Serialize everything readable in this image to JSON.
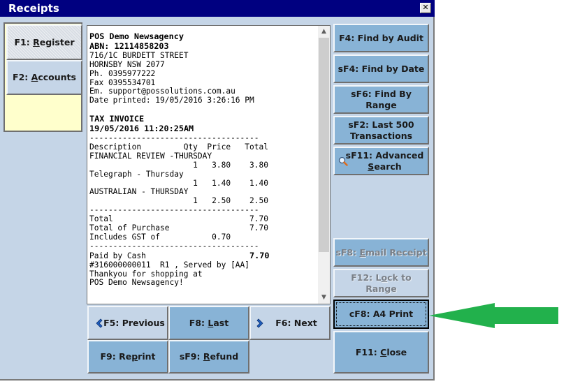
{
  "window": {
    "title": "Receipts",
    "close_glyph": "✕"
  },
  "left_panel": {
    "register": {
      "key": "F1: ",
      "mnemonic": "R",
      "rest": "egister"
    },
    "accounts": {
      "key": "F2: ",
      "mnemonic": "A",
      "rest": "ccounts"
    }
  },
  "receipt": {
    "store_name": "POS Demo Newsagency",
    "abn": "ABN: 12114858203",
    "address1": "716/1C BURDETT STREET",
    "address2": "HORNSBY NSW 2077",
    "phone": "Ph. 0395977222",
    "fax": "Fax 0395534701",
    "email": "Em. support@possolutions.com.au",
    "date_printed": "Date printed: 19/05/2016 3:26:16 PM",
    "doc_type": "TAX INVOICE",
    "transaction_datetime": "19/05/2016 11:20:25AM",
    "divider": "------------------------------------",
    "columns": {
      "description": "Description",
      "qty": "Qty",
      "price": "Price",
      "total": "Total"
    },
    "items": [
      {
        "description": "FINANCIAL REVIEW -THURSDAY",
        "qty": "1",
        "price": "3.80",
        "total": "3.80"
      },
      {
        "description": "Telegraph - Thursday",
        "qty": "1",
        "price": "1.40",
        "total": "1.40"
      },
      {
        "description": "AUSTRALIAN - THURSDAY",
        "qty": "1",
        "price": "2.50",
        "total": "2.50"
      }
    ],
    "total_label": "Total",
    "total_value": "7.70",
    "purchase_label": "Total of Purchase",
    "purchase_value": "7.70",
    "gst_label": "Includes GST of",
    "gst_value": "0.70",
    "paid_label": "Paid by Cash",
    "paid_value": "7.70",
    "ref_line": "#316000000011  R1 , Served by [AA]",
    "thanks1": "Thankyou for shopping at",
    "thanks2": "POS Demo Newsagency!"
  },
  "nav_buttons": {
    "previous": "F5: Previous",
    "last": {
      "key": "F8: ",
      "mnemonic": "L",
      "rest": "ast"
    },
    "next": "F6: Next",
    "reprint": {
      "key": "F9: Re",
      "mnemonic": "p",
      "rest": "rint"
    },
    "refund": {
      "key": "sF9: ",
      "mnemonic": "R",
      "rest": "efund"
    }
  },
  "right_buttons": {
    "find_audit": "F4: Find by Audit",
    "find_date": "sF4: Find by Date",
    "find_range": "sF6: Find By Range",
    "last500_line1": "sF2: Last 500",
    "last500_line2": "Transactions",
    "advanced_line1": "sF11: Advanced",
    "advanced_mnemonic": "S",
    "advanced_rest": "earch",
    "email": {
      "key": "sF8: ",
      "mnemonic": "E",
      "rest": "mail Receipt"
    },
    "lock": {
      "key": "F12: L",
      "mnemonic": "o",
      "rest": "ck to Range"
    },
    "a4_print": "cF8: A4 Print",
    "close": {
      "key": "F11: ",
      "mnemonic": "C",
      "rest": "lose"
    }
  },
  "colors": {
    "annotation_arrow": "#22b14c",
    "title_bar": "#000080",
    "button": "#88b3d6"
  }
}
